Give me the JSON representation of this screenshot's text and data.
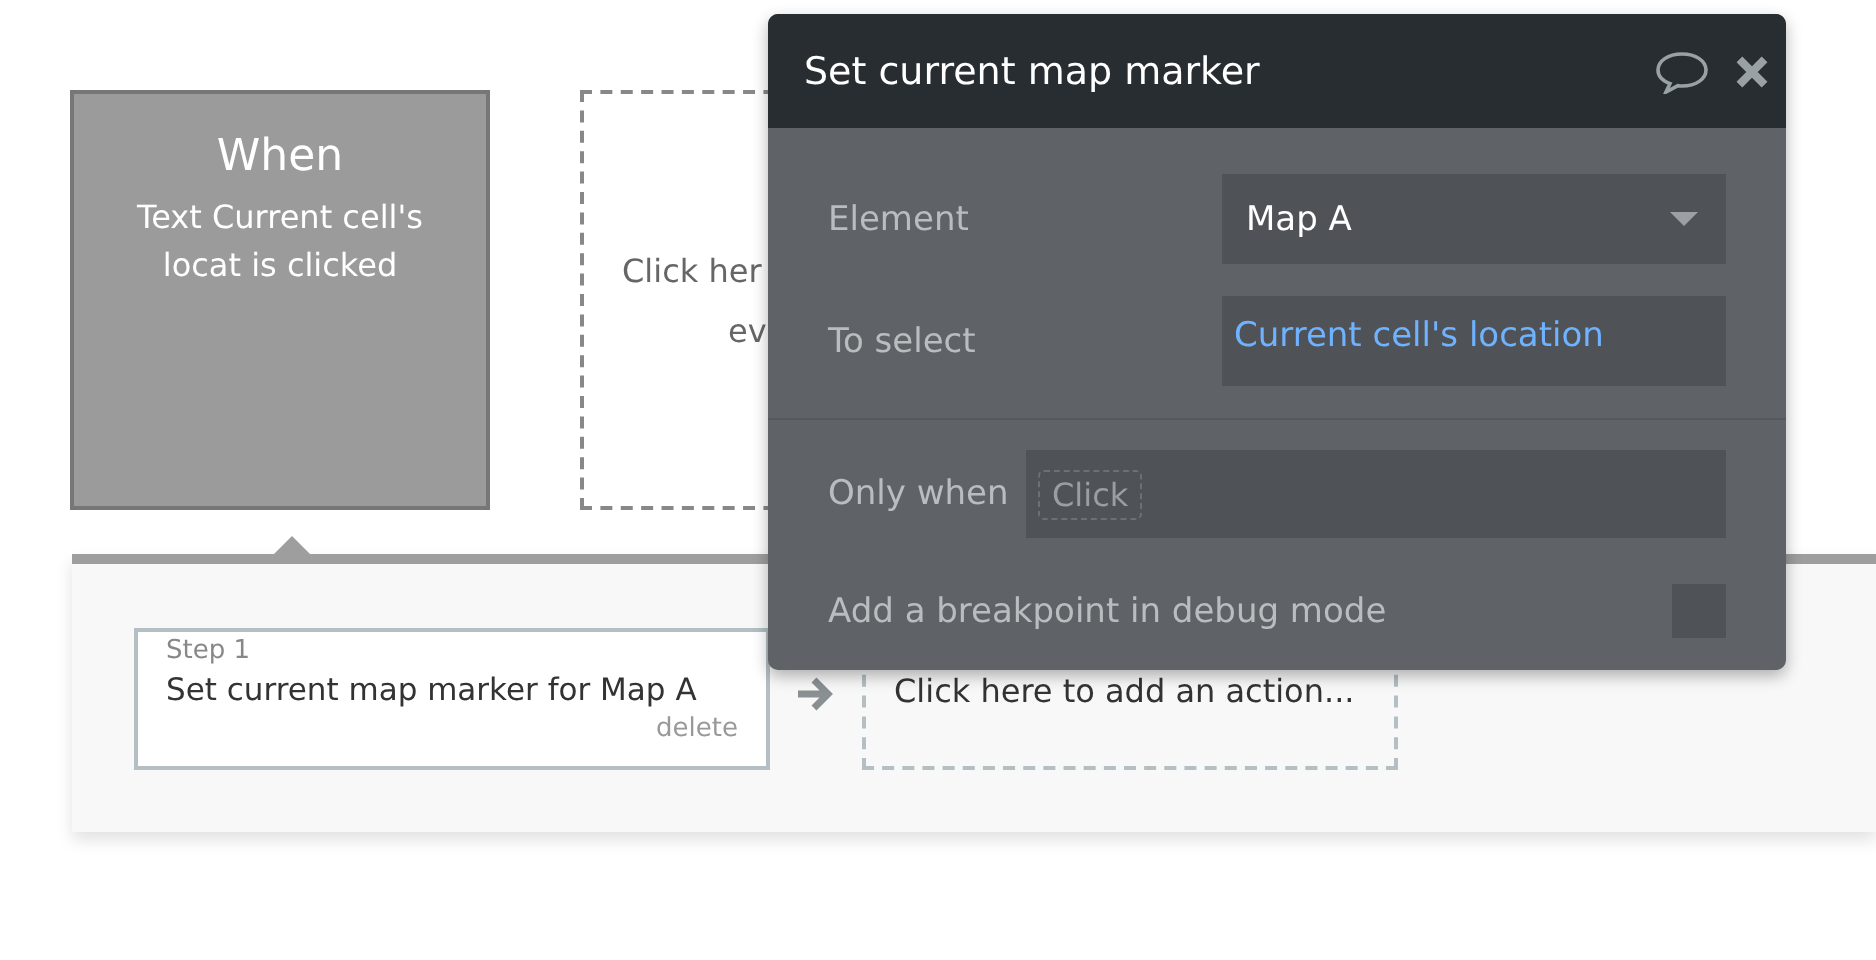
{
  "trigger": {
    "title": "When",
    "description": "Text Current cell's locat is clicked"
  },
  "event_placeholder": {
    "lines": [
      "Click her",
      "ev"
    ]
  },
  "actions": [
    {
      "kind": "step",
      "step_label": "Step 1",
      "text": "Set current map marker for Map A",
      "delete": "delete"
    },
    {
      "kind": "add",
      "text": "Click here to add an action..."
    }
  ],
  "popup": {
    "title": "Set current map marker",
    "fields": [
      {
        "kind": "dropdown",
        "label": "Element",
        "value": "Map A"
      },
      {
        "kind": "expression",
        "label": "To select",
        "value": "Current cell's location"
      },
      {
        "kind": "condition",
        "label": "Only when",
        "placeholder": "Click"
      },
      {
        "kind": "checkbox",
        "label": "Add a breakpoint in debug mode",
        "checked": false
      }
    ]
  }
}
